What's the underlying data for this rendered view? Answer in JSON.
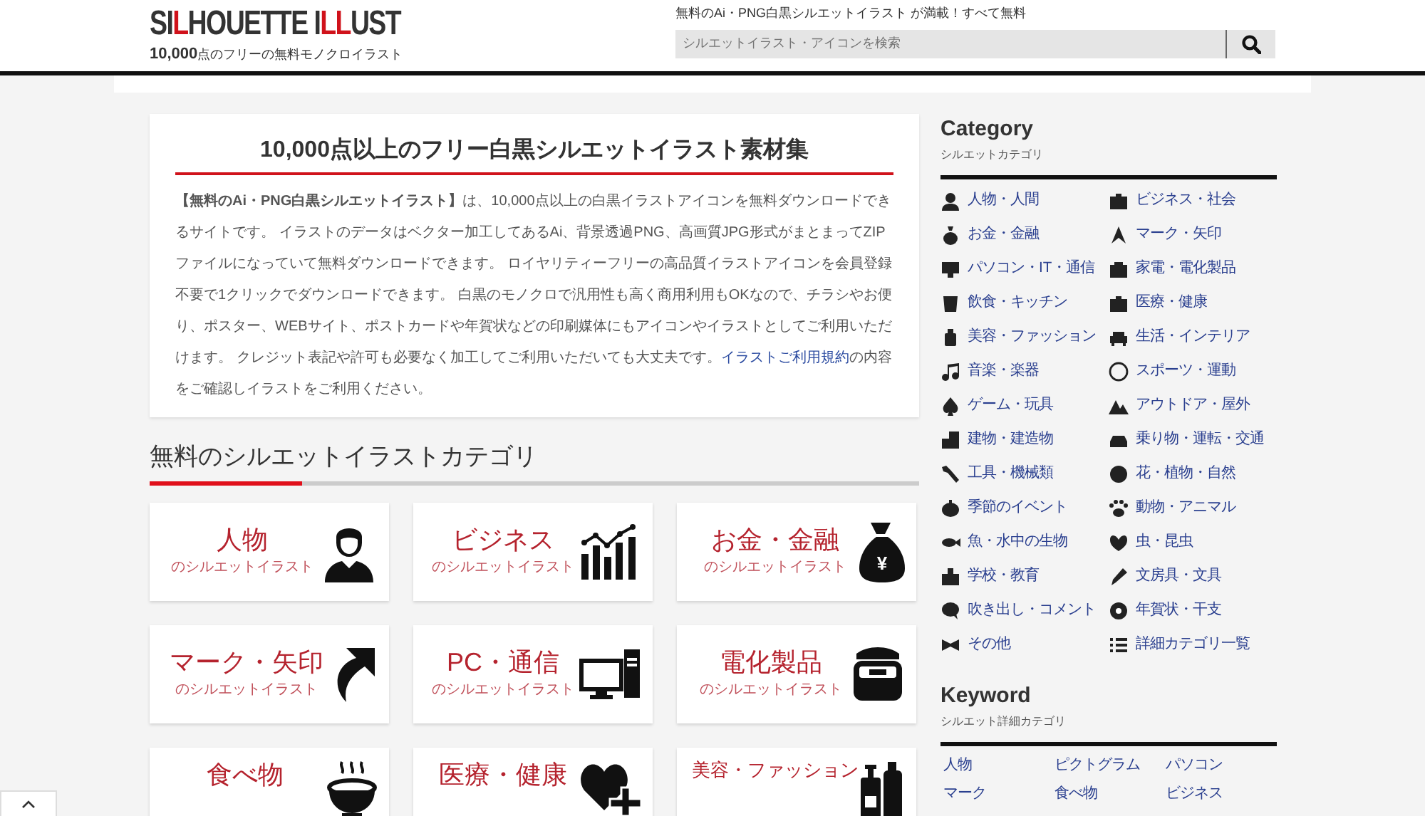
{
  "header": {
    "logo_parts": [
      {
        "text": "SI",
        "accent": false
      },
      {
        "text": "L",
        "accent": true
      },
      {
        "text": "HOUETTE I",
        "accent": false
      },
      {
        "text": "LL",
        "accent": true
      },
      {
        "text": "UST",
        "accent": false
      }
    ],
    "tagline_number": "10,000",
    "tagline": "点のフリーの無料モノクロイラスト",
    "notice": "無料のAi・PNG白黒シルエットイラスト が満載！すべて無料",
    "search": {
      "placeholder": "シルエットイラスト・アイコンを検索"
    }
  },
  "intro": {
    "title": "10,000点以上のフリー白黒シルエットイラスト素材集",
    "text_before": "**【無料のAi・PNG白黒シルエットイラスト】**は、10,000点以上の白黒イラストアイコンを無料ダウンロードできるサイトです。 イラストのデータはベクター加工してあるAi、背景透過PNG、高画質JPG形式がまとまってZIPファイルになっていて無料ダウンロードできます。 ロイヤリティーフリーの高品質イラストアイコンを会員登録不要で1クリックでダウンロードできます。 白黒のモノクロで汎用性も高く商用利用もOKなので、チラシやお便り、ポスター、WEBサイト、ポストカードや年賀状などの印刷媒体にもアイコンやイラストとしてご利用いただけます。 クレジット表記や許可も必要なく加工してご利用いただいても大丈夫です。",
    "link": "イラストご利用規約",
    "text_after": "の内容をご確認しイラストをご利用ください。"
  },
  "categories_section": {
    "title": "無料のシルエットイラストカテゴリ",
    "tiles": [
      {
        "title": "人物",
        "subtitle": "のシルエットイラスト"
      },
      {
        "title": "ビジネス",
        "subtitle": "のシルエットイラスト"
      },
      {
        "title": "お金・金融",
        "subtitle": "のシルエットイラスト",
        "icon_label": "¥"
      },
      {
        "title": "マーク・矢印",
        "subtitle": "のシルエットイラスト"
      },
      {
        "title": "PC・通信",
        "subtitle": "のシルエットイラスト"
      },
      {
        "title": "電化製品",
        "subtitle": "のシルエットイラスト"
      },
      {
        "title": "食べ物"
      },
      {
        "title": "医療・健康"
      },
      {
        "title": "美容・ファッション"
      }
    ]
  },
  "sidebar": {
    "category": {
      "title": "Category",
      "subtitle": "シルエットカテゴリ",
      "items": [
        "人物・人間",
        "ビジネス・社会",
        "お金・金融",
        "マーク・矢印",
        "パソコン・IT・通信",
        "家電・電化製品",
        "飲食・キッチン",
        "医療・健康",
        "美容・ファッション",
        "生活・インテリア",
        "音楽・楽器",
        "スポーツ・運動",
        "ゲーム・玩具",
        "アウトドア・屋外",
        "建物・建造物",
        "乗り物・運転・交通",
        "工具・機械類",
        "花・植物・自然",
        "季節のイベント",
        "動物・アニマル",
        "魚・水中の生物",
        "虫・昆虫",
        "学校・教育",
        "文房具・文具",
        "吹き出し・コメント",
        "年賀状・干支",
        "その他",
        "詳細カテゴリ一覧"
      ]
    },
    "keyword": {
      "title": "Keyword",
      "subtitle": "シルエット詳細カテゴリ",
      "items": [
        "人物",
        "ピクトグラム",
        "パソコン",
        "マーク",
        "食べ物",
        "ビジネス"
      ]
    }
  }
}
